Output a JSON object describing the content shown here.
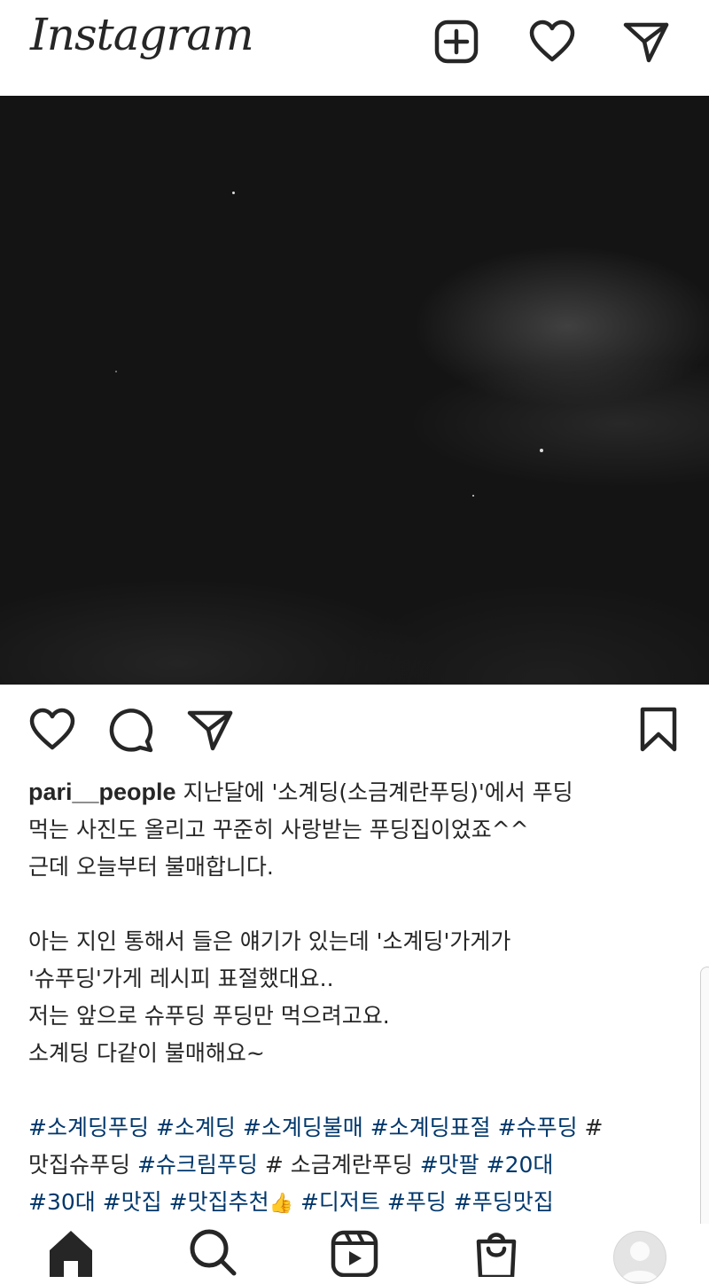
{
  "app": {
    "name": "Instagram",
    "icons": {
      "new_post": "plus-square-icon",
      "activity": "heart-icon",
      "direct": "paper-plane-icon"
    }
  },
  "post": {
    "media": {
      "description": "night-sky-photo"
    },
    "actions": {
      "like": "heart-icon",
      "comment": "comment-bubble-icon",
      "share": "paper-plane-icon",
      "save": "bookmark-icon"
    },
    "caption": {
      "username": "pari__people",
      "lines": [
        " 지난달에 '소계딩(소금계란푸딩)'에서 푸딩",
        "먹는 사진도 올리고 꾸준히 사랑받는 푸딩집이었죠^^",
        "근데 오늘부터 불매합니다.",
        "아는 지인 통해서 들은 얘기가 있는데 '소계딩'가게가",
        "'슈푸딩'가게 레시피 표절했대요..",
        "저는 앞으로 슈푸딩 푸딩만 먹으려고요.",
        "소계딩 다같이 불매해요~"
      ],
      "hashtag_lines": {
        "l1": [
          "#소계딩푸딩",
          "#소계딩",
          "#소계딩불매",
          "#소계딩표절",
          "#슈푸딩",
          "#"
        ],
        "l2_plain": "맛집슈푸딩",
        "l2_tag": "#슈크림푸딩",
        "l2_plain2": "# 소금계란푸딩",
        "l2_tags": [
          "#맛팔",
          "#20대"
        ],
        "l3": [
          "#30대",
          "#맛집",
          "#맛집추천"
        ],
        "l3_emoji": "👍",
        "l3_rest": [
          "#디저트",
          "#푸딩",
          "#푸딩맛집"
        ]
      }
    }
  },
  "bottom_nav": {
    "items": [
      "home-icon",
      "search-icon",
      "reels-icon",
      "shop-bag-icon",
      "profile-avatar"
    ]
  },
  "colors": {
    "text": "#262626",
    "hashtag": "#00376b",
    "photo_bg": "#141414"
  }
}
